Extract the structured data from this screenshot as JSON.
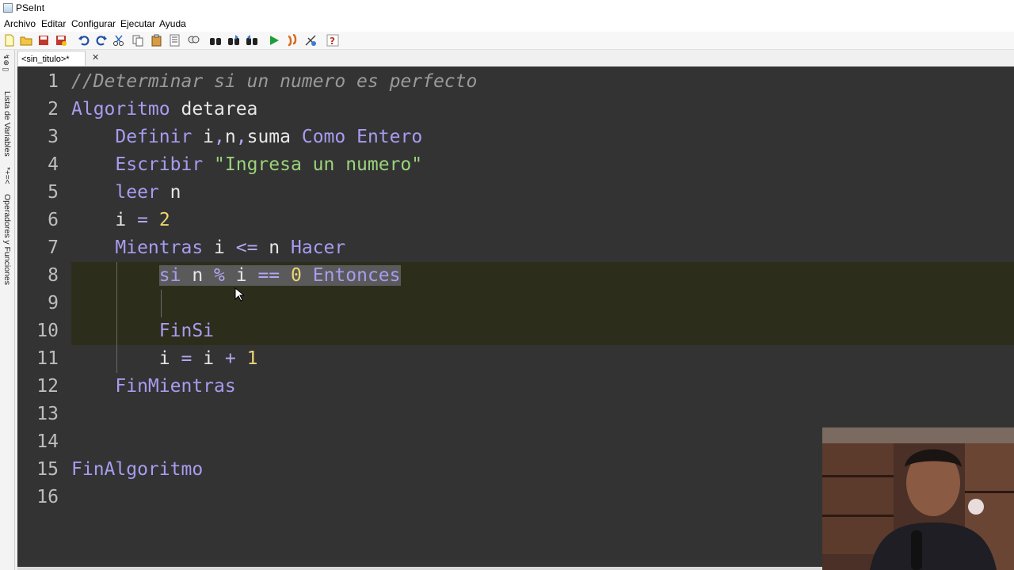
{
  "window": {
    "title": "PSeInt"
  },
  "menu": [
    "Archivo",
    "Editar",
    "Configurar",
    "Ejecutar",
    "Ayuda"
  ],
  "toolbar_icons": [
    "new-file-icon",
    "open-folder-icon",
    "save-icon",
    "save-as-icon",
    "undo-icon",
    "redo-icon",
    "cut-icon",
    "copy-icon",
    "paste-icon",
    "list-icon",
    "find-icon",
    "binoculars-icon",
    "find-next-icon",
    "find-prev-icon",
    "run-icon",
    "step-icon",
    "debug-icon",
    "help-icon"
  ],
  "tab": {
    "label": "<sin_titulo>*",
    "close": "✕"
  },
  "side_panel": {
    "variables": "Lista de Variables",
    "operators": "Operadores y Funciones",
    "operators_symbol": "*+=<"
  },
  "editor": {
    "lines": [
      {
        "n": "1",
        "text": "//Determinar si un numero es perfecto"
      },
      {
        "n": "2",
        "text": "Algoritmo detarea"
      },
      {
        "n": "3",
        "text": "    Definir i,n,suma Como Entero"
      },
      {
        "n": "4",
        "text": "    Escribir \"Ingresa un numero\""
      },
      {
        "n": "5",
        "text": "    leer n"
      },
      {
        "n": "6",
        "text": "    i = 2"
      },
      {
        "n": "7",
        "text": "    Mientras i <= n Hacer"
      },
      {
        "n": "8",
        "text": "        si n % i == 0 Entonces"
      },
      {
        "n": "9",
        "text": ""
      },
      {
        "n": "10",
        "text": "        FinSi"
      },
      {
        "n": "11",
        "text": "        i = i + 1"
      },
      {
        "n": "12",
        "text": "    FinMientras"
      },
      {
        "n": "13",
        "text": ""
      },
      {
        "n": "14",
        "text": ""
      },
      {
        "n": "15",
        "text": "FinAlgoritmo"
      },
      {
        "n": "16",
        "text": ""
      }
    ],
    "selected_line": "8"
  },
  "colors": {
    "editor_bg": "#333333",
    "keyword": "#a79cf0",
    "comment": "#9a9a9a",
    "string": "#9ad37b",
    "number": "#ecd771",
    "highlight_band": "#2d2d1c"
  }
}
